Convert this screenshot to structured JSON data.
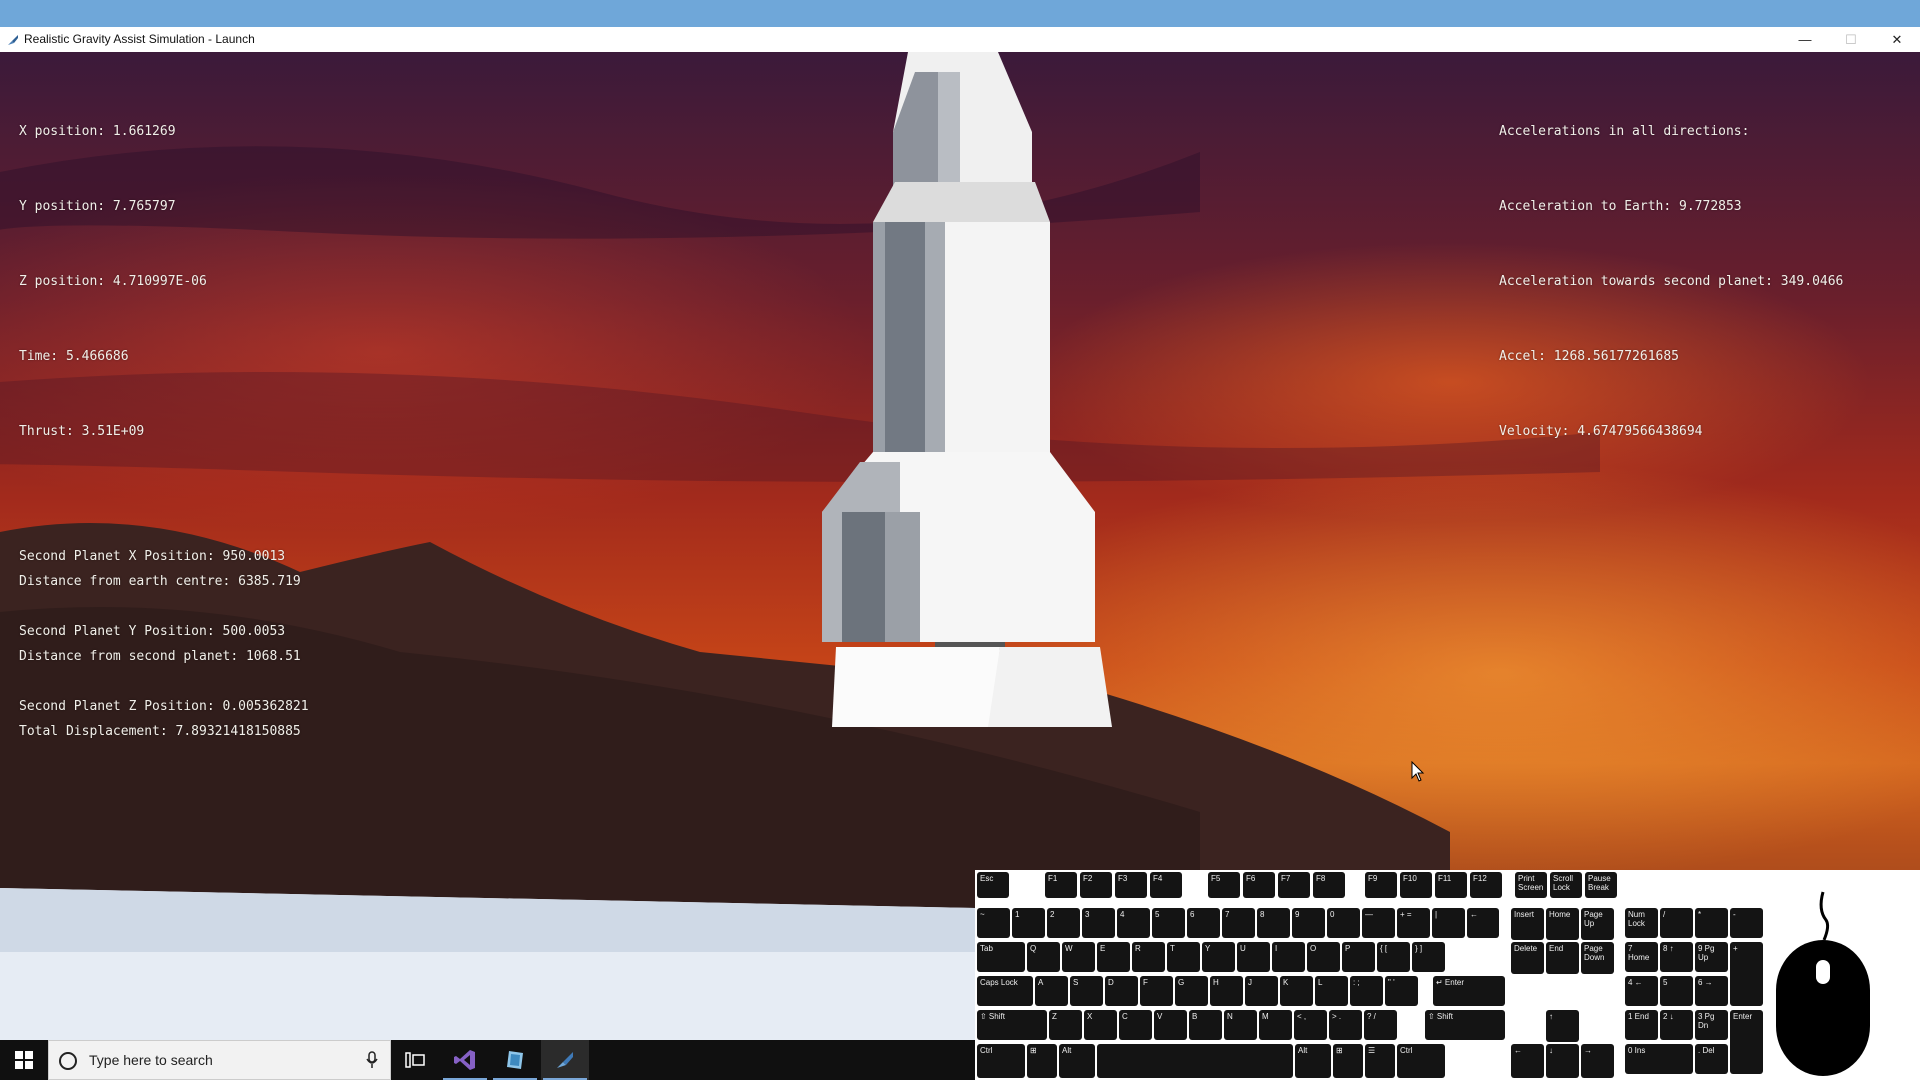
{
  "window": {
    "title": "Realistic Gravity Assist Simulation - Launch",
    "controls": [
      "minimize",
      "maximize",
      "close"
    ]
  },
  "hud_left": {
    "position": [
      "X position: 1.661269",
      "Y position: 7.765797",
      "Z position: 4.710997E-06",
      "Time: 5.466686",
      "Thrust: 3.51E+09"
    ],
    "distances": [
      "Distance from earth centre: 6385.719",
      "Distance from second planet: 1068.51",
      "Total Displacement: 7.89321418150885"
    ],
    "planet": [
      "Second Planet X Position: 950.0013",
      "Second Planet Y Position: 500.0053",
      "Second Planet Z Position: 0.005362821"
    ]
  },
  "hud_right": [
    "Accelerations in all directions:",
    "Acceleration to Earth: 9.772853",
    "Acceleration towards second planet: 349.0466",
    "Accel: 1268.56177261685",
    "Velocity: 4.67479566438694"
  ],
  "keyboard": {
    "function_row": [
      "Esc",
      "F1",
      "F2",
      "F3",
      "F4",
      "F5",
      "F6",
      "F7",
      "F8",
      "F9",
      "F10",
      "F11",
      "F12",
      "Print Screen",
      "Scroll Lock",
      "Pause Break"
    ],
    "number_row": [
      "~",
      "1",
      "2",
      "3",
      "4",
      "5",
      "6",
      "7",
      "8",
      "9",
      "0",
      "—",
      "+ =",
      "|",
      "←"
    ],
    "qwerty_row": [
      "Tab",
      "Q",
      "W",
      "E",
      "R",
      "T",
      "Y",
      "U",
      "I",
      "O",
      "P",
      "{ [",
      "} ]"
    ],
    "home_row": [
      "Caps Lock",
      "A",
      "S",
      "D",
      "F",
      "G",
      "H",
      "J",
      "K",
      "L",
      ": ;",
      "\" '",
      "Enter"
    ],
    "shift_row": [
      "Shift",
      "Z",
      "X",
      "C",
      "V",
      "B",
      "N",
      "M",
      "< ,",
      "> .",
      "? /",
      "Shift"
    ],
    "bottom_row": [
      "Ctrl",
      "Alt",
      "Alt",
      "Ctrl"
    ],
    "nav_keys": [
      "Insert",
      "Home",
      "Page Up",
      "Delete",
      "End",
      "Page Down"
    ],
    "arrow_keys": [
      "↑",
      "←",
      "↓",
      "→"
    ],
    "numpad": [
      "Num Lock",
      "/",
      "*",
      "-",
      "7 Home",
      "8 ↑",
      "9 Pg Up",
      "+",
      "4 ←",
      "5",
      "6 →",
      "1 End",
      "2 ↓",
      "3 Pg Dn",
      "Enter",
      "0 Ins",
      ". Del"
    ]
  },
  "taskbar": {
    "search_placeholder": "Type here to search",
    "apps": [
      "task-view",
      "visual-studio",
      "unity",
      "simulation-app"
    ]
  },
  "colors": {
    "hud_text": "#f1efe9",
    "taskbar": "#101010",
    "key": "#141414"
  }
}
